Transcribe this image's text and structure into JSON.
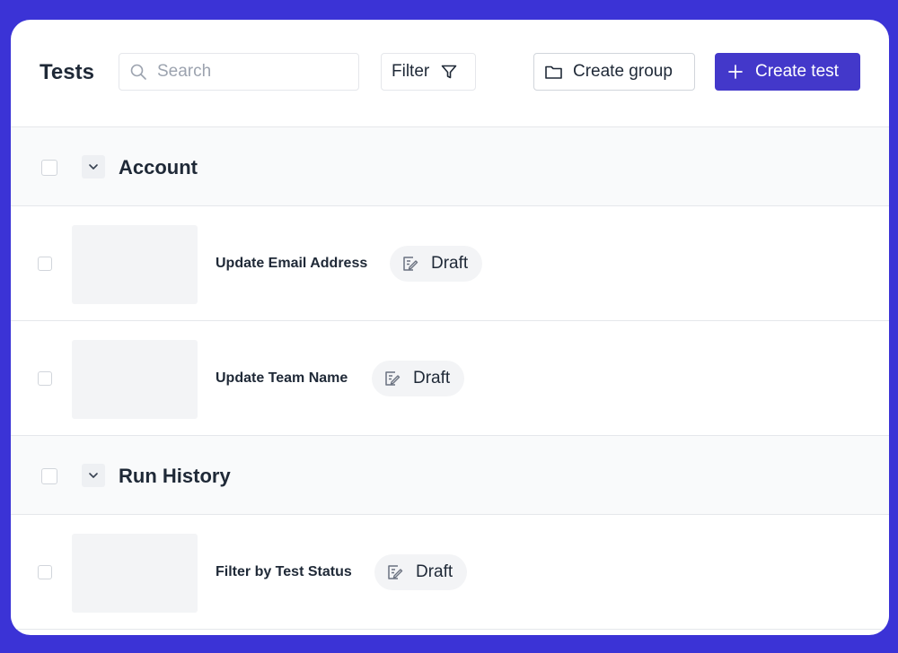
{
  "header": {
    "title": "Tests",
    "search_placeholder": "Search",
    "search_value": "",
    "filter_label": "Filter",
    "create_group_label": "Create group",
    "create_test_label": "Create test"
  },
  "colors": {
    "accent": "#4338ca",
    "backdrop": "#3b33d6",
    "group_row_bg": "#f9fafb",
    "badge_bg": "#f3f4f6"
  },
  "groups": [
    {
      "name": "Account",
      "tests": [
        {
          "name": "Update Email Address",
          "status": "Draft",
          "status_icon": "draft-edit-icon"
        },
        {
          "name": "Update Team Name",
          "status": "Draft",
          "status_icon": "draft-edit-icon"
        }
      ]
    },
    {
      "name": "Run History",
      "tests": [
        {
          "name": "Filter by Test Status",
          "status": "Draft",
          "status_icon": "draft-edit-icon"
        }
      ]
    }
  ]
}
